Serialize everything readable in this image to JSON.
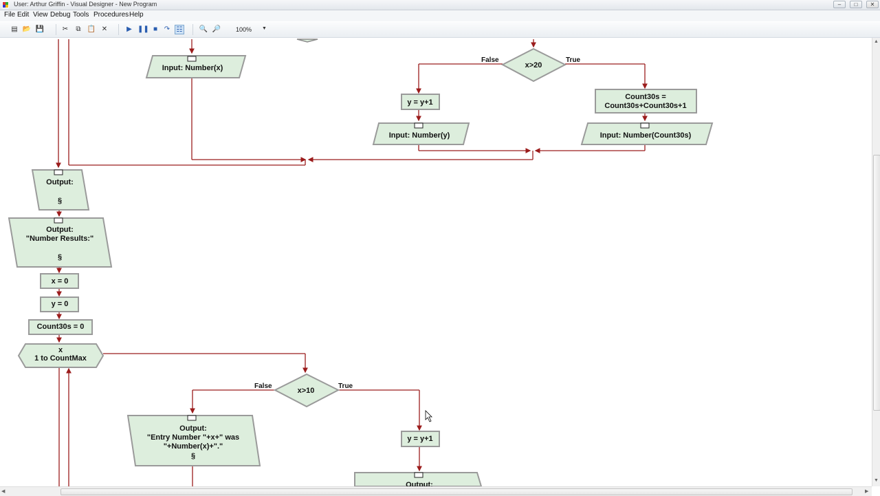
{
  "window": {
    "title": "User: Arthur Griffin - Visual Designer - New Program",
    "controls": [
      "–",
      "□",
      "✕"
    ]
  },
  "menu": [
    "File",
    "Edit",
    "View",
    "Debug",
    "Tools",
    "Procedures",
    "Help"
  ],
  "toolbar": {
    "zoom": "100%",
    "icons": [
      "new-icon",
      "open-icon",
      "save-icon",
      "cut-icon",
      "copy-icon",
      "paste-icon",
      "delete-icon",
      "run-icon",
      "pause-icon",
      "stop-icon",
      "step-icon",
      "toggle-view-icon",
      "zoom-in-icon",
      "zoom-out-icon"
    ]
  },
  "flowchart": {
    "input_x": "Input: Number(x)",
    "decision_x20": "x>20",
    "false_top": "False",
    "true_top": "True",
    "y_inc_top": "y = y+1",
    "count30s_l1": "Count30s =",
    "count30s_l2": "Count30s+Count30s+1",
    "input_y": "Input: Number(y)",
    "input_count30s": "Input: Number(Count30s)",
    "output1_label": "Output:",
    "section_mark": "§",
    "output2_label": "Output:",
    "output2_text": "\"Number Results:\"",
    "x_init": "x = 0",
    "y_init": "y = 0",
    "count30s_init": "Count30s = 0",
    "loop_var": "x",
    "loop_range": "1 to CountMax",
    "decision_x10": "x>10",
    "false_bottom": "False",
    "true_bottom": "True",
    "output3_label": "Output:",
    "output3_l1": "\"Entry Number \"+x+\" was",
    "output3_l2": "\"+Number(x)+\".\"",
    "y_inc_bottom": "y = y+1",
    "output4_label": "Output:"
  },
  "colors": {
    "shape_fill": "#ddeedd",
    "connector": "#9b1c1c",
    "shadow": "#8c8c8c"
  }
}
